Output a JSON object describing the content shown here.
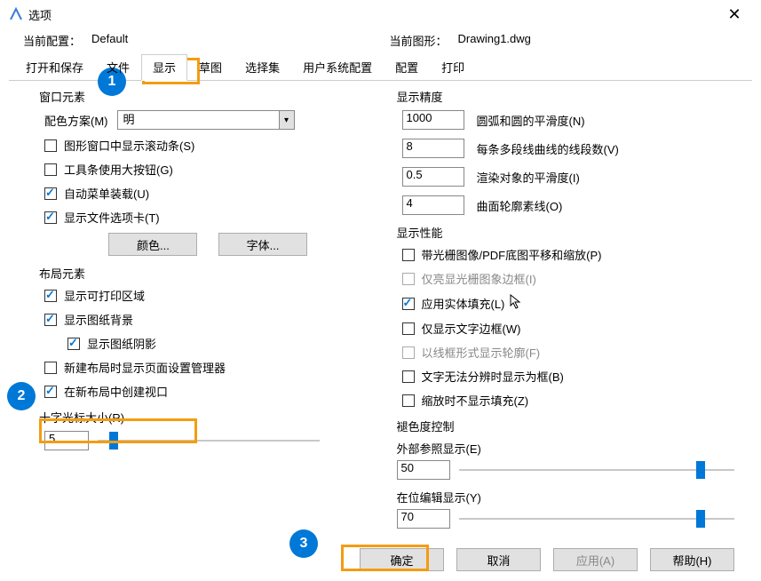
{
  "window": {
    "title": "选项",
    "close": "✕"
  },
  "info": {
    "config_label": "当前配置：",
    "config_value": "Default",
    "drawing_label": "当前图形：",
    "drawing_value": "Drawing1.dwg"
  },
  "tabs": [
    "打开和保存",
    "文件",
    "显示",
    "草图",
    "选择集",
    "用户系统配置",
    "配置",
    "打印"
  ],
  "active_tab": "显示",
  "left": {
    "window_group": "窗口元素",
    "scheme_label": "配色方案(M)",
    "scheme_value": "明",
    "scrollbar": "图形窗口中显示滚动条(S)",
    "bigbtn": "工具条使用大按钮(G)",
    "autoload": "自动菜单装载(U)",
    "filetab": "显示文件选项卡(T)",
    "color_btn": "颜色...",
    "font_btn": "字体...",
    "layout_group": "布局元素",
    "printable": "显示可打印区域",
    "paperbg": "显示图纸背景",
    "shadow": "显示图纸阴影",
    "pagesetup": "新建布局时显示页面设置管理器",
    "viewport": "在新布局中创建视口",
    "crosshair_label": "十字光标大小(R)",
    "crosshair_value": "5"
  },
  "right": {
    "precision_group": "显示精度",
    "arc_val": "1000",
    "arc_label": "圆弧和圆的平滑度(N)",
    "poly_val": "8",
    "poly_label": "每条多段线曲线的线段数(V)",
    "render_val": "0.5",
    "render_label": "渲染对象的平滑度(I)",
    "surf_val": "4",
    "surf_label": "曲面轮廓素线(O)",
    "perf_group": "显示性能",
    "raster": "带光栅图像/PDF底图平移和缩放(P)",
    "highlight": "仅亮显光栅图象边框(I)",
    "solidfill": "应用实体填充(L)",
    "textframe": "仅显示文字边框(W)",
    "wireframe": "以线框形式显示轮廓(F)",
    "textbox": "文字无法分辨时显示为框(B)",
    "zoomfill": "缩放时不显示填充(Z)",
    "fade_group": "褪色度控制",
    "xref_label": "外部参照显示(E)",
    "xref_val": "50",
    "inplace_label": "在位编辑显示(Y)",
    "inplace_val": "70"
  },
  "footer": {
    "ok": "确定",
    "cancel": "取消",
    "apply": "应用(A)",
    "help": "帮助(H)"
  },
  "badges": {
    "b1": "1",
    "b2": "2",
    "b3": "3"
  }
}
